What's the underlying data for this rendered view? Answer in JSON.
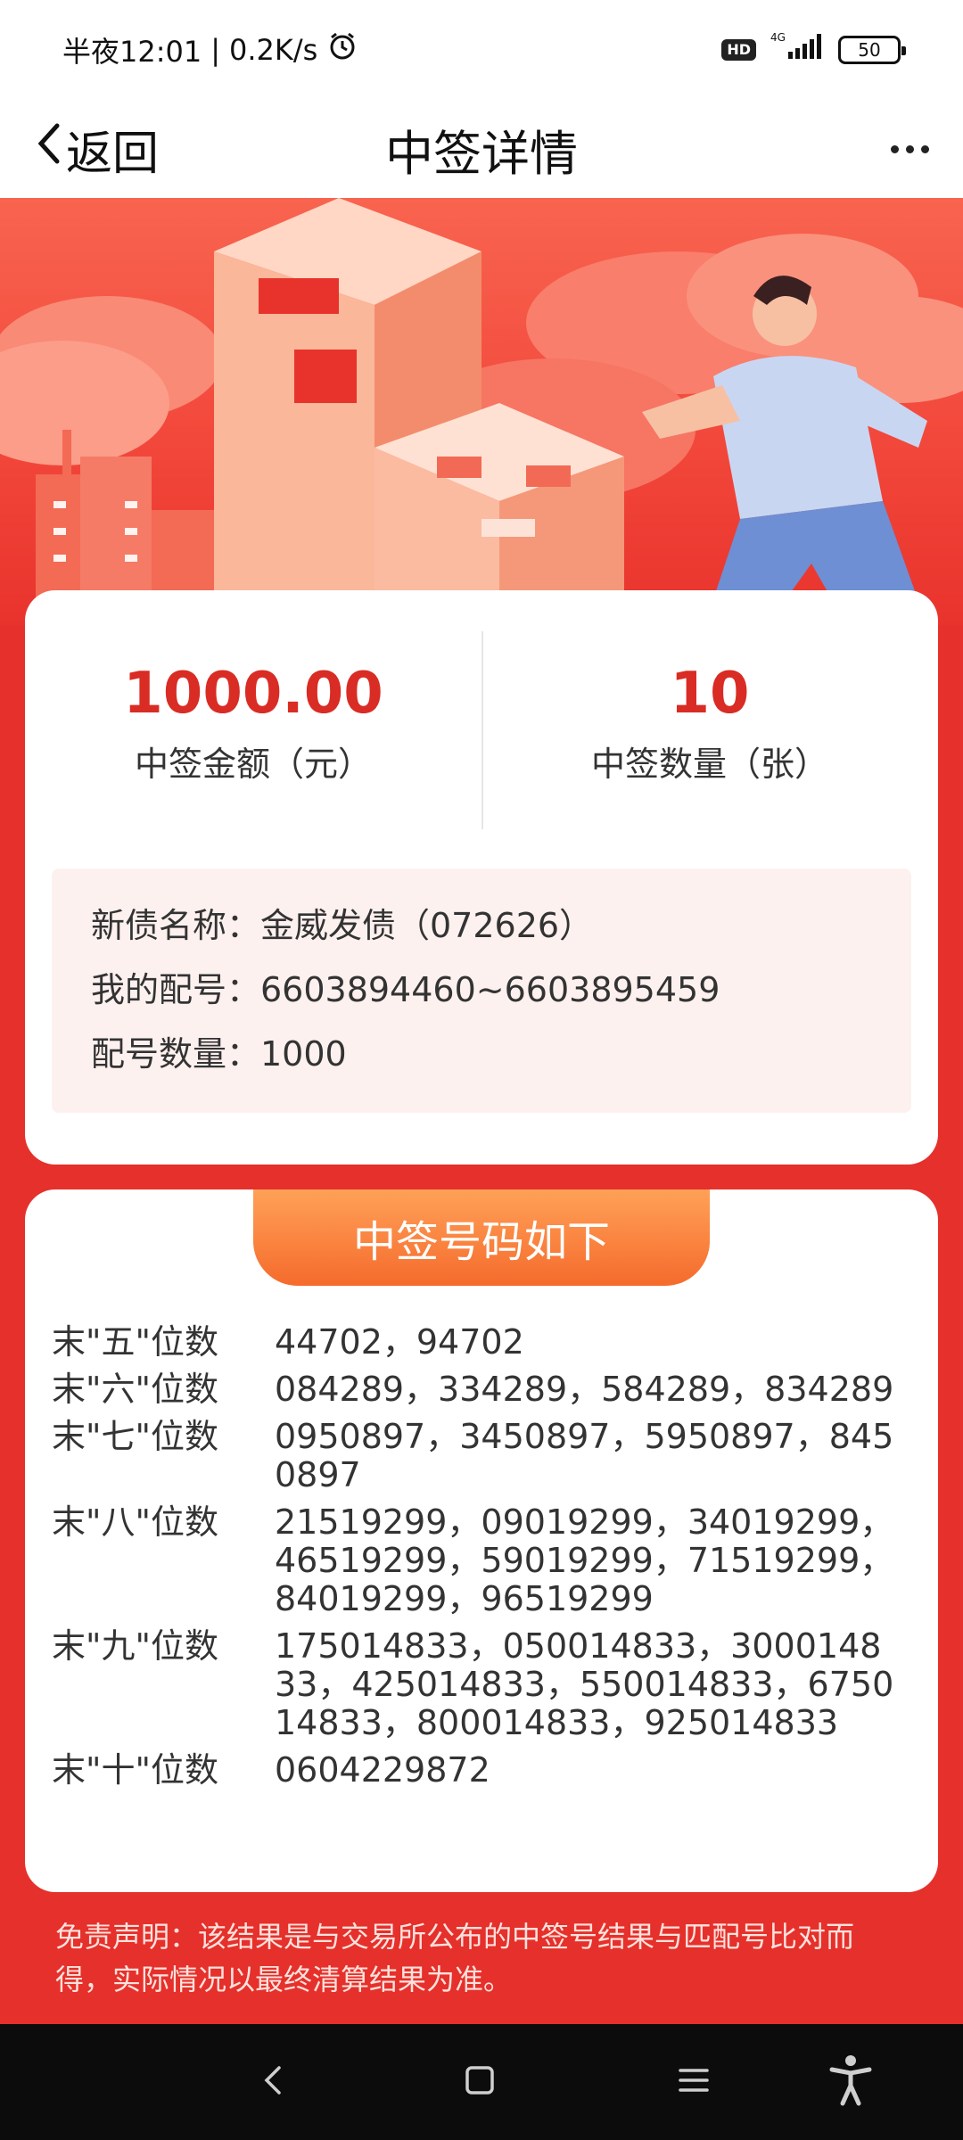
{
  "status_bar": {
    "time": "半夜12:01",
    "speed": "0.2K/s",
    "hd": "HD",
    "network": "4G",
    "battery": "50"
  },
  "nav": {
    "back_label": "返回",
    "title": "中签详情"
  },
  "summary": {
    "amount_value": "1000.00",
    "amount_label": "中签金额（元）",
    "count_value": "10",
    "count_label": "中签数量（张）"
  },
  "info": {
    "bond_name": "新债名称：金威发债（072626）",
    "my_numbers": "我的配号：6603894460~6603895459",
    "number_count": "配号数量：1000"
  },
  "winning": {
    "header": "中签号码如下",
    "rows": [
      {
        "label": "末\"五\"位数",
        "values": "44702，94702"
      },
      {
        "label": "末\"六\"位数",
        "values": "084289，334289，584289，834289"
      },
      {
        "label": "末\"七\"位数",
        "values": "0950897，3450897，5950897，8450897"
      },
      {
        "label": "末\"八\"位数",
        "values": "21519299，09019299，34019299，46519299，59019299，71519299，84019299，96519299"
      },
      {
        "label": "末\"九\"位数",
        "values": "175014833，050014833，300014833，425014833，550014833，675014833，800014833，925014833"
      },
      {
        "label": "末\"十\"位数",
        "values": "0604229872"
      }
    ]
  },
  "disclaimer": "免责声明：该结果是与交易所公布的中签号结果与匹配号比对而得，实际情况以最终清算结果为准。",
  "colors": {
    "accent_red": "#e5302b",
    "value_red": "#d92c24",
    "header_orange": "#f56b2c"
  }
}
